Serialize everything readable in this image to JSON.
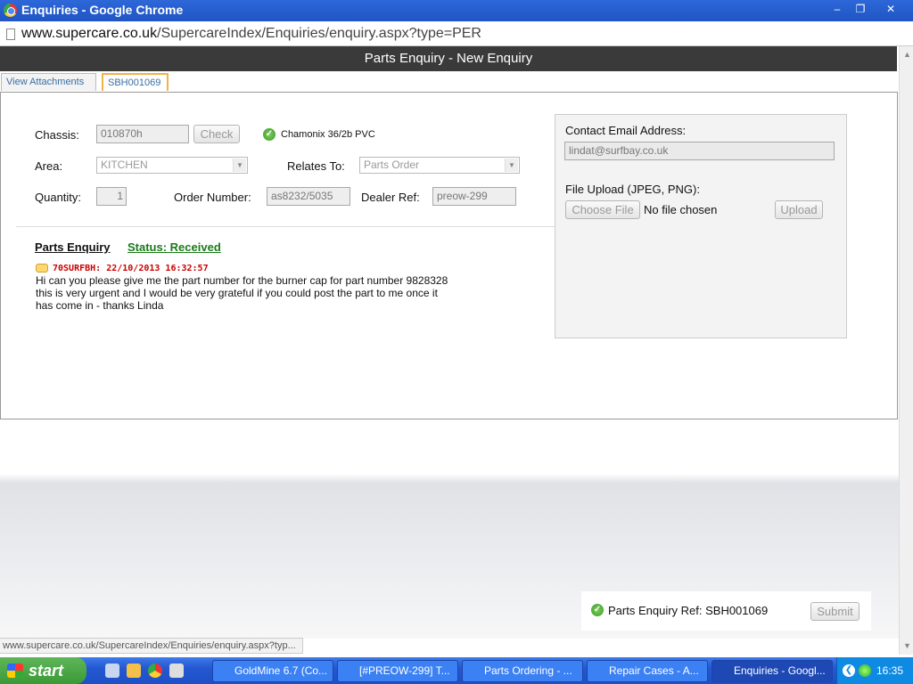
{
  "window": {
    "title": "Enquiries - Google Chrome",
    "minimize": "–",
    "maximize": "❐",
    "close": "✕"
  },
  "address": {
    "domain": "www.supercare.co.uk",
    "path": "/SupercareIndex/Enquiries/enquiry.aspx?type=PER"
  },
  "page": {
    "header": "Parts Enquiry - New Enquiry",
    "tabs": [
      "View Attachments",
      "SBH001069"
    ]
  },
  "form": {
    "chassis_label": "Chassis:",
    "chassis_value": "010870h",
    "check_label": "Check",
    "model_text": "Chamonix 36/2b PVC",
    "area_label": "Area:",
    "area_value": "KITCHEN",
    "relates_label": "Relates To:",
    "relates_value": "Parts Order",
    "quantity_label": "Quantity:",
    "quantity_value": "1",
    "order_label": "Order Number:",
    "order_value": "as8232/5035",
    "dealer_label": "Dealer Ref:",
    "dealer_value": "preow-299"
  },
  "contact": {
    "email_label": "Contact Email Address:",
    "email_value": "lindat@surfbay.co.uk",
    "upload_label": "File Upload (JPEG, PNG):",
    "choose_file": "Choose File",
    "no_file": "No file chosen",
    "upload_button": "Upload"
  },
  "enquiry": {
    "title": "Parts Enquiry",
    "status": "Status: Received",
    "message_header": "70SURFBH: 22/10/2013 16:32:57",
    "message_body": "Hi can you please give me the part number for the burner cap for part number 9828328 this is very urgent and I would be very grateful if you could post the part to me once it has come in - thanks Linda"
  },
  "footer": {
    "ref_text": "Parts Enquiry Ref: SBH001069",
    "submit": "Submit",
    "status_url": "www.supercare.co.uk/SupercareIndex/Enquiries/enquiry.aspx?typ..."
  },
  "taskbar": {
    "start": "start",
    "tasks": [
      "GoldMine 6.7 (Co...",
      "[#PREOW-299] T...",
      "Parts Ordering - ...",
      "Repair Cases - A...",
      "Enquiries - Googl..."
    ],
    "clock": "16:35"
  },
  "colors": {
    "header_bg": "#3a3a3a",
    "status_green": "#1a7a1a",
    "message_red": "#cc0000",
    "tab_border": "#f0b24a"
  }
}
